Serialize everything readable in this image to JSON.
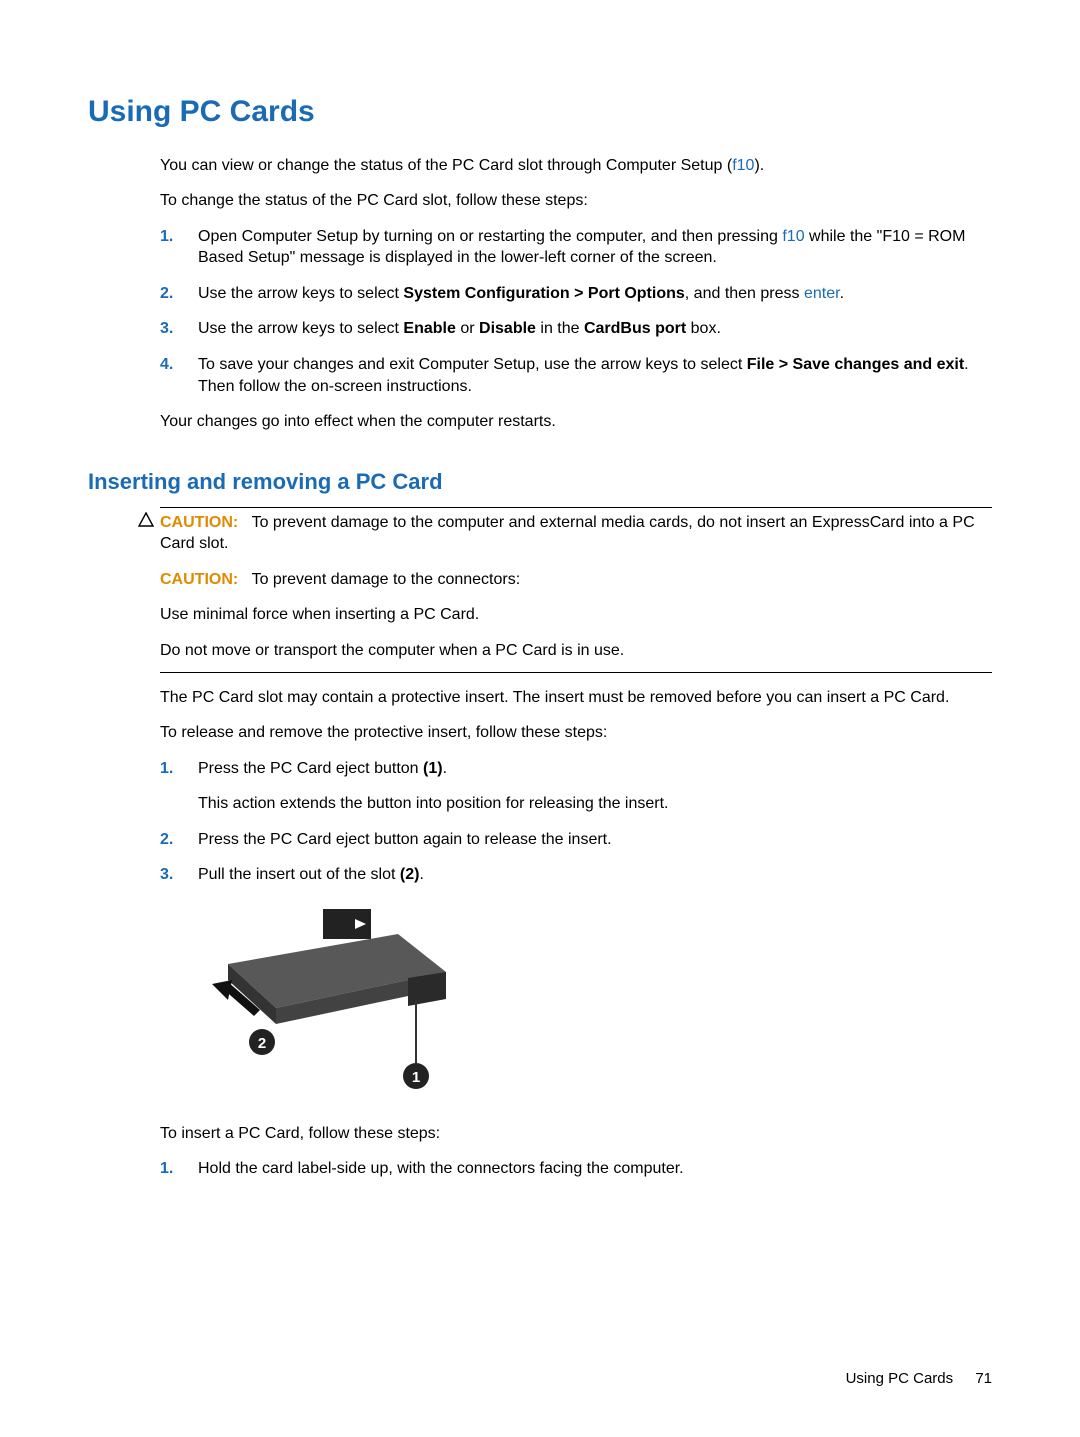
{
  "h1": "Using PC Cards",
  "intro": {
    "p1a": "You can view or change the status of the PC Card slot through Computer Setup (",
    "p1_link": "f10",
    "p1b": ").",
    "p2": "To change the status of the PC Card slot, follow these steps:"
  },
  "steps1": {
    "n1": "1.",
    "s1a": "Open Computer Setup by turning on or restarting the computer, and then pressing ",
    "s1_link": "f10",
    "s1b": " while the \"F10 = ROM Based Setup\" message is displayed in the lower-left corner of the screen.",
    "n2": "2.",
    "s2a": "Use the arrow keys to select ",
    "s2_bold": "System Configuration > Port Options",
    "s2b": ", and then press ",
    "s2_link": "enter",
    "s2c": ".",
    "n3": "3.",
    "s3a": "Use the arrow keys to select ",
    "s3_bold1": "Enable",
    "s3b": " or ",
    "s3_bold2": "Disable",
    "s3c": " in the ",
    "s3_bold3": "CardBus port",
    "s3d": " box.",
    "n4": "4.",
    "s4a": "To save your changes and exit Computer Setup, use the arrow keys to select ",
    "s4_bold": "File > Save changes and exit",
    "s4b": ". Then follow the on-screen instructions."
  },
  "post1": "Your changes go into effect when the computer restarts.",
  "h2": "Inserting and removing a PC Card",
  "caution1": {
    "label": "CAUTION:",
    "body": "To prevent damage to the computer and external media cards, do not insert an ExpressCard into a PC Card slot."
  },
  "caution2": {
    "label": "CAUTION:",
    "p1": "To prevent damage to the connectors:",
    "p2": "Use minimal force when inserting a PC Card.",
    "p3": "Do not move or transport the computer when a PC Card is in use."
  },
  "mid": {
    "p1": "The PC Card slot may contain a protective insert. The insert must be removed before you can insert a PC Card.",
    "p2": "To release and remove the protective insert, follow these steps:"
  },
  "steps2": {
    "n1": "1.",
    "s1a": "Press the PC Card eject button ",
    "s1_bold": "(1)",
    "s1b": ".",
    "s1_sub": "This action extends the button into position for releasing the insert.",
    "n2": "2.",
    "s2": "Press the PC Card eject button again to release the insert.",
    "n3": "3.",
    "s3a": "Pull the insert out of the slot ",
    "s3_bold": "(2)",
    "s3b": "."
  },
  "post2": "To insert a PC Card, follow these steps:",
  "steps3": {
    "n1": "1.",
    "s1": "Hold the card label-side up, with the connectors facing the computer."
  },
  "footer": {
    "title": "Using PC Cards",
    "page": "71"
  }
}
